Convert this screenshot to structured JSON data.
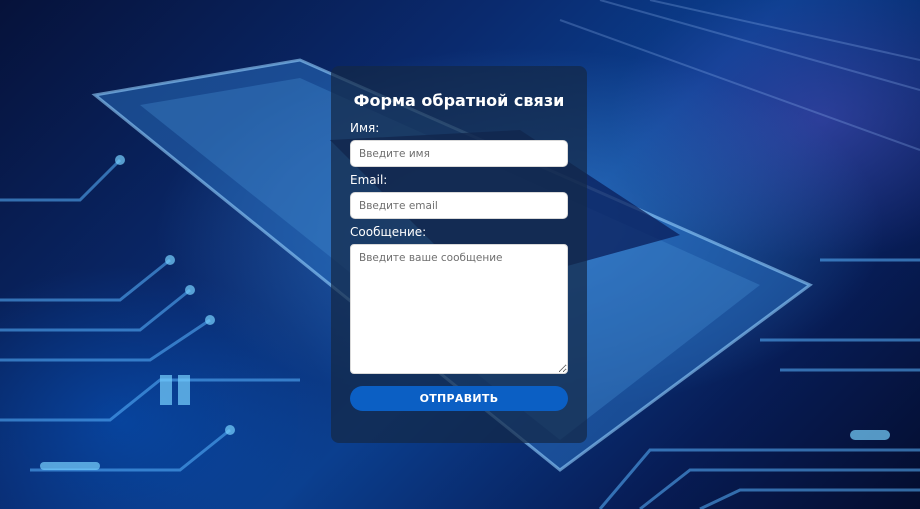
{
  "form": {
    "title": "Форма обратной связи",
    "name_label": "Имя:",
    "name_placeholder": "Введите имя",
    "email_label": "Email:",
    "email_placeholder": "Введите email",
    "message_label": "Сообщение:",
    "message_placeholder": "Введите ваше сообщение",
    "submit_label": "ОТПРАВИТЬ"
  },
  "colors": {
    "button": "#0b5fc4",
    "card_bg": "rgba(20,40,70,0.72)"
  }
}
